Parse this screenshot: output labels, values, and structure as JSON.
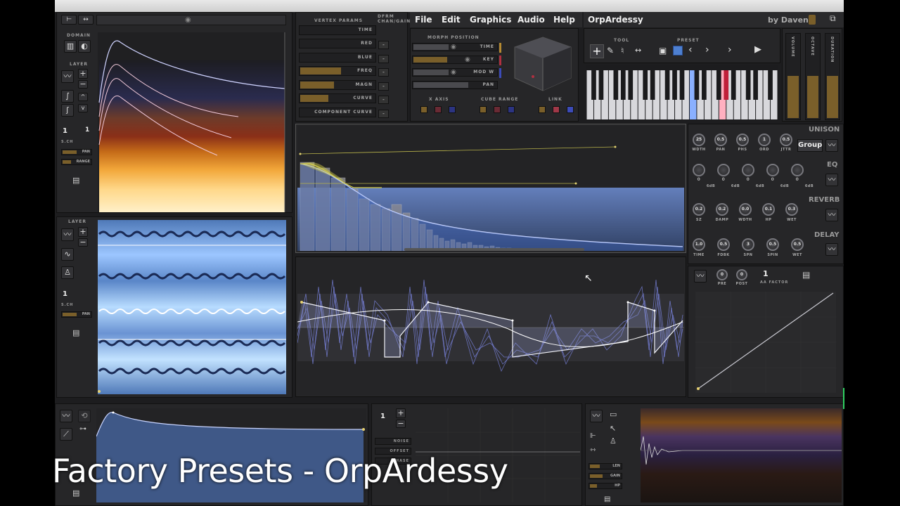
{
  "window": {
    "title": "OrpArdessy",
    "author": "by Daven"
  },
  "menu": [
    "File",
    "Edit",
    "Graphics",
    "Audio",
    "Help"
  ],
  "left_top": {
    "domain_label": "DOMAIN",
    "layer_label": "LAYER",
    "sch_value": "1",
    "sch_label": "S.CH",
    "ch2_value": "1",
    "pan_label": "PAN",
    "range_label": "RANGE"
  },
  "left_bottom": {
    "layer_label": "LAYER",
    "sch_value": "1",
    "sch_label": "S.CH",
    "pan_label": "PAN"
  },
  "vertex": {
    "header": "VERTEX PARAMS",
    "header2": "DFRM CHAN/GAIN",
    "rows": [
      {
        "label": "TIME",
        "fill": 0
      },
      {
        "label": "RED",
        "fill": 0
      },
      {
        "label": "BLUE",
        "fill": 0
      },
      {
        "label": "FREQ",
        "fill": 0.55
      },
      {
        "label": "MAGN",
        "fill": 0.45
      },
      {
        "label": "CURVE",
        "fill": 0.38
      },
      {
        "label": "COMPONENT CURVE",
        "fill": 0
      }
    ]
  },
  "morph": {
    "header": "MORPH POSITION",
    "rows": [
      "TIME",
      "KEY",
      "MOD W",
      "PAN"
    ],
    "x_axis": "X AXIS",
    "cube_range": "CUBE RANGE",
    "link": "LINK"
  },
  "tool": {
    "tool_label": "TOOL",
    "preset_label": "PRESET"
  },
  "sliders": [
    "VOLUME",
    "OCTAVE",
    "DURATION"
  ],
  "unison": {
    "title": "UNISON",
    "group_btn": "Group",
    "knobs": [
      {
        "value": "25",
        "label": "WDTH"
      },
      {
        "value": "0.5",
        "label": "PAN"
      },
      {
        "value": "0.5",
        "label": "PHS"
      },
      {
        "value": "1",
        "label": "ORD"
      },
      {
        "value": "0.5",
        "label": "JTTR"
      }
    ]
  },
  "eq": {
    "title": "EQ",
    "knobs": [
      {
        "value": "0",
        "label": "6dB"
      },
      {
        "value": "0",
        "label": "6dB"
      },
      {
        "value": "0",
        "label": "6dB"
      },
      {
        "value": "0",
        "label": "6dB"
      },
      {
        "value": "0",
        "label": "6dB"
      }
    ]
  },
  "reverb": {
    "title": "REVERB",
    "knobs": [
      {
        "value": "0.2",
        "label": "SZ"
      },
      {
        "value": "0.2",
        "label": "DAMP"
      },
      {
        "value": "0.0",
        "label": "WDTH"
      },
      {
        "value": "0.1",
        "label": "HP"
      },
      {
        "value": "0.3",
        "label": "WET"
      }
    ]
  },
  "delay": {
    "title": "DELAY",
    "knobs": [
      {
        "value": "1.0",
        "label": "TIME"
      },
      {
        "value": "0.5",
        "label": "FDBK"
      },
      {
        "value": "3",
        "label": "SPN"
      },
      {
        "value": "0.5",
        "label": "SPIN"
      },
      {
        "value": "0.5",
        "label": "WET"
      }
    ]
  },
  "aa": {
    "pre_value": "0",
    "pre_label": "PRE",
    "post_value": "0",
    "post_label": "POST",
    "factor_value": "1",
    "factor_label": "AA FACTOR"
  },
  "bottom_mid": {
    "num": "1",
    "noise": "NOISE",
    "offset": "OFFSET",
    "phase": "PHASE"
  },
  "bottom_right": {
    "lbl1": "LEN",
    "lbl2": "GAIN",
    "lbl3": "HP"
  },
  "caption": "Factory Presets - OrpArdessy"
}
